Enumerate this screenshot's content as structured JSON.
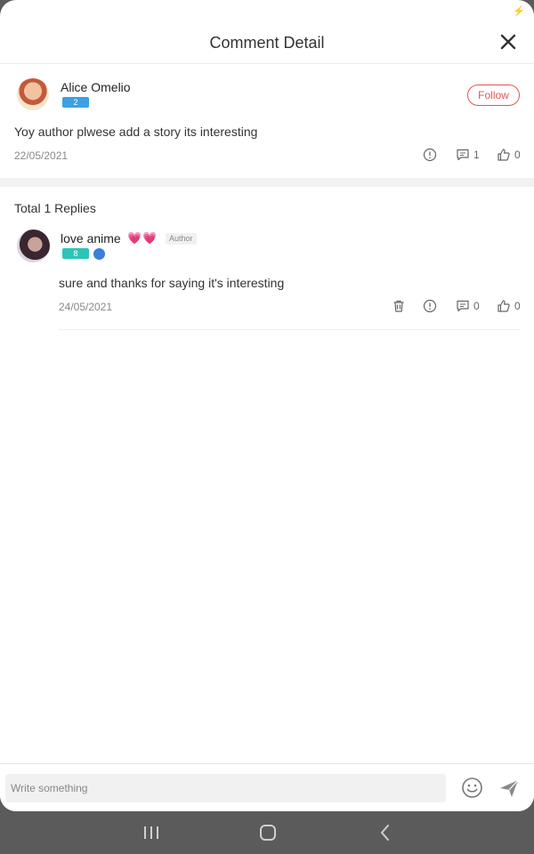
{
  "header": {
    "title": "Comment Detail"
  },
  "main_comment": {
    "author": "Alice Omelio",
    "level": "2",
    "follow_label": "Follow",
    "text": "Yoy author plwese add a story its interesting",
    "date": "22/05/2021",
    "reply_count": "1",
    "like_count": "0"
  },
  "replies": {
    "total_label": "Total 1 Replies",
    "items": [
      {
        "author": "love anime",
        "author_tag": "Author",
        "level": "8",
        "text": "sure and thanks for saying it's interesting",
        "date": "24/05/2021",
        "reply_count": "0",
        "like_count": "0"
      }
    ]
  },
  "composer": {
    "placeholder": "Write something"
  },
  "colors": {
    "accent": "#e6534f",
    "level_blue": "#3ba0e6",
    "level_teal": "#2ec4b6",
    "heart": "#f03e94"
  },
  "icons": [
    "close-icon",
    "report-icon",
    "comment-icon",
    "like-icon",
    "delete-icon",
    "emoji-icon",
    "send-icon",
    "recent-apps-icon",
    "home-icon",
    "back-icon"
  ]
}
